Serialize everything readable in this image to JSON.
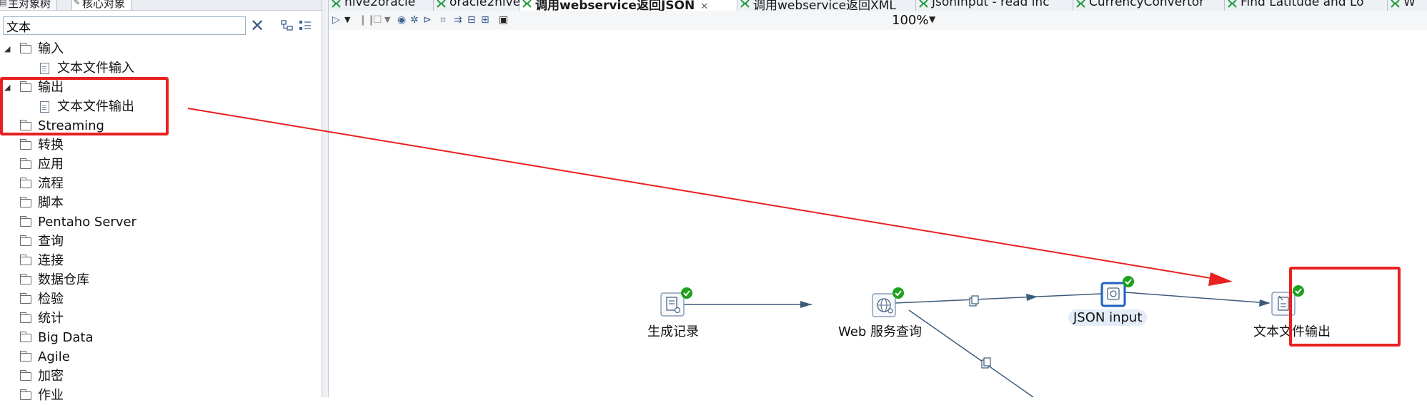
{
  "left_panel": {
    "tabs": [
      {
        "label": "主对象树",
        "active": false
      },
      {
        "label": "核心对象",
        "active": true
      }
    ],
    "search": {
      "value": "文本"
    },
    "tree": [
      {
        "label": "输入",
        "kind": "folder",
        "expanded": true
      },
      {
        "label": "文本文件输入",
        "kind": "file"
      },
      {
        "label": "输出",
        "kind": "folder",
        "expanded": true
      },
      {
        "label": "文本文件输出",
        "kind": "file"
      },
      {
        "label": "Streaming",
        "kind": "folder"
      },
      {
        "label": "转换",
        "kind": "folder"
      },
      {
        "label": "应用",
        "kind": "folder"
      },
      {
        "label": "流程",
        "kind": "folder"
      },
      {
        "label": "脚本",
        "kind": "folder"
      },
      {
        "label": "Pentaho Server",
        "kind": "folder"
      },
      {
        "label": "查询",
        "kind": "folder"
      },
      {
        "label": "连接",
        "kind": "folder"
      },
      {
        "label": "数据仓库",
        "kind": "folder"
      },
      {
        "label": "检验",
        "kind": "folder"
      },
      {
        "label": "统计",
        "kind": "folder"
      },
      {
        "label": "Big Data",
        "kind": "folder"
      },
      {
        "label": "Agile",
        "kind": "folder"
      },
      {
        "label": "加密",
        "kind": "folder"
      },
      {
        "label": "作业",
        "kind": "folder"
      }
    ]
  },
  "editor": {
    "tabs": [
      {
        "label": "hive2oracle",
        "active": false
      },
      {
        "label": "oracle2hive",
        "active": false
      },
      {
        "label": "调用webservice返回JSON",
        "active": true,
        "close": "✕"
      },
      {
        "label": "调用webservice返回XML",
        "active": false
      },
      {
        "label": "JsonInput - read inc",
        "active": false
      },
      {
        "label": "CurrencyConvertor",
        "active": false
      },
      {
        "label": "Find Latitude and Lo",
        "active": false
      },
      {
        "label": "W",
        "active": false
      }
    ],
    "toolbar": {
      "zoom": "100%"
    },
    "steps": [
      {
        "label": "生成记录",
        "icon": "generate-rows-icon"
      },
      {
        "label": "Web 服务查询",
        "icon": "web-service-icon"
      },
      {
        "label": "JSON input",
        "icon": "json-input-icon"
      },
      {
        "label": "文本文件输出",
        "icon": "text-file-output-icon"
      }
    ]
  },
  "colors": {
    "annotation_red": "#e8201f",
    "hop_blue": "#3d5a7a",
    "ok_green": "#1fa01f",
    "selection_blue": "#1f5fbf"
  }
}
